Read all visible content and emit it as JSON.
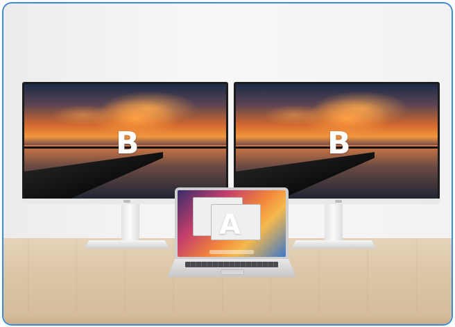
{
  "scene": {
    "description_labels": {
      "left_monitor_letter": "B",
      "right_monitor_letter": "B",
      "laptop_letter": "A"
    },
    "colors": {
      "frame_border": "#3a8ad6",
      "wall": "#f2f2f2",
      "desk": "#dcc6a7"
    }
  }
}
